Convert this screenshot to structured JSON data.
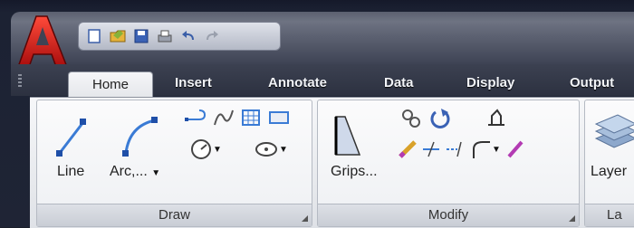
{
  "colors": {
    "accent": "#c81e1e",
    "tab_active_bg": "#eef0f3",
    "ribbon_bg": "#eceef1"
  },
  "app": {
    "logo_letter": "A"
  },
  "quick_access_toolbar": {
    "icons": [
      "new-file-icon",
      "open-folder-icon",
      "save-icon",
      "plot-icon",
      "undo-icon",
      "redo-icon"
    ]
  },
  "ribbon_tabs": [
    {
      "label": "Home",
      "active": true
    },
    {
      "label": "Insert"
    },
    {
      "label": "Annotate"
    },
    {
      "label": "Data"
    },
    {
      "label": "Display"
    },
    {
      "label": "Output"
    }
  ],
  "panels": {
    "draw": {
      "title": "Draw",
      "line_label": "Line",
      "arc_label": "Arc,...",
      "icons": [
        "polyline-icon",
        "spline-icon",
        "hatch-icon",
        "rectangle-icon",
        "circle-icon",
        "ellipse-icon"
      ]
    },
    "modify": {
      "title": "Modify",
      "grips_label": "Grips...",
      "icons": [
        "copy-icon",
        "rotate-icon",
        "stretch-icon",
        "erase-icon",
        "trim-icon",
        "extend-icon",
        "fillet-icon",
        "pencil-icon"
      ]
    },
    "layers": {
      "title": "La",
      "layer_label": "Layer"
    }
  }
}
